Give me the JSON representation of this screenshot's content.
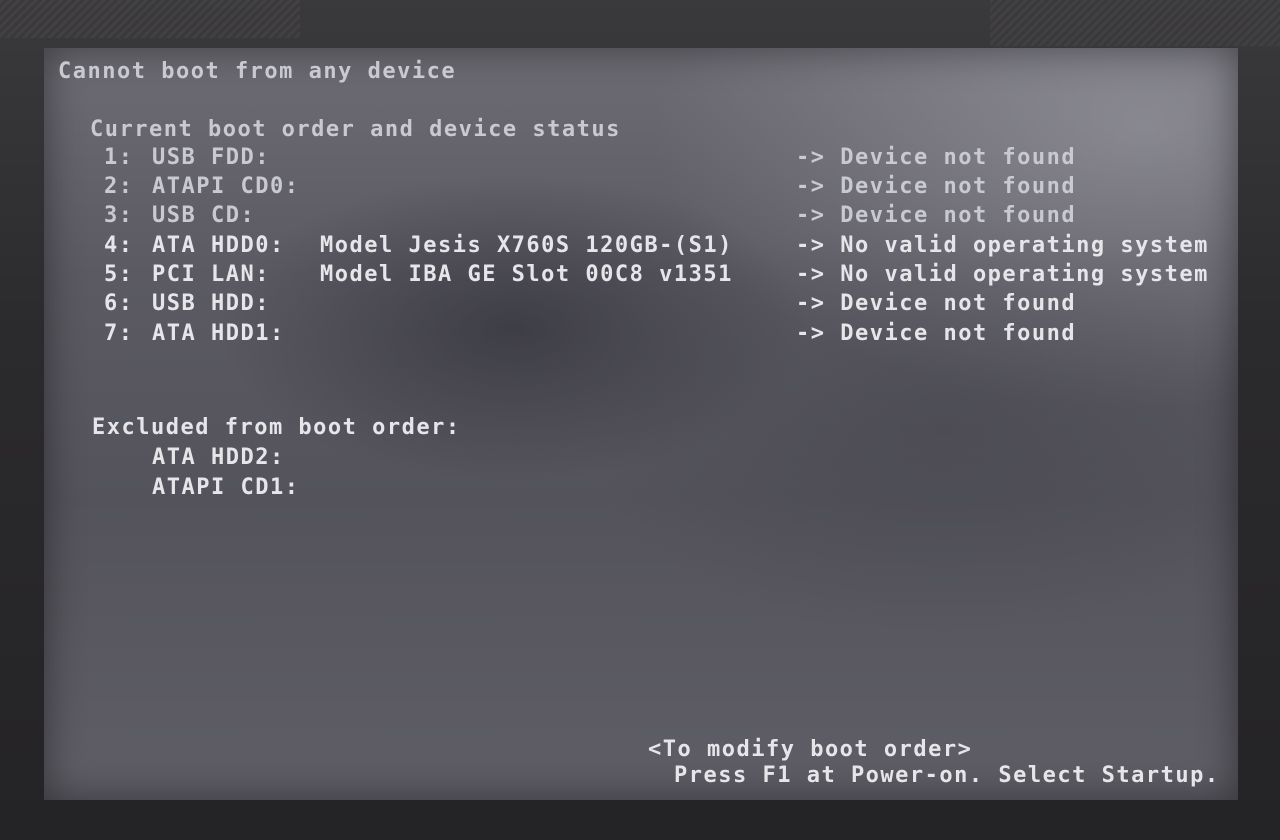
{
  "header": {
    "error_title": "Cannot boot from any device"
  },
  "boot_order": {
    "title": "Current boot order and device status",
    "items": [
      {
        "index": "1:",
        "device": "USB FDD:",
        "model": "",
        "status": "-> Device not found"
      },
      {
        "index": "2:",
        "device": "ATAPI CD0:",
        "model": "",
        "status": "-> Device not found"
      },
      {
        "index": "3:",
        "device": "USB CD:",
        "model": "",
        "status": "-> Device not found"
      },
      {
        "index": "4:",
        "device": "ATA HDD0:",
        "model": "Model Jesis X760S 120GB-(S1)",
        "status": "-> No valid operating system"
      },
      {
        "index": "5:",
        "device": "PCI LAN:",
        "model": "Model IBA GE Slot 00C8 v1351",
        "status": "-> No valid operating system"
      },
      {
        "index": "6:",
        "device": "USB HDD:",
        "model": "",
        "status": "-> Device not found"
      },
      {
        "index": "7:",
        "device": "ATA HDD1:",
        "model": "",
        "status": "-> Device not found"
      }
    ]
  },
  "excluded": {
    "title": "Excluded from boot order:",
    "items": [
      "ATA HDD2:",
      "ATAPI CD1:"
    ]
  },
  "footer": {
    "hint": "<To modify boot order>",
    "instruction": "Press F1 at Power-on. Select Startup."
  }
}
